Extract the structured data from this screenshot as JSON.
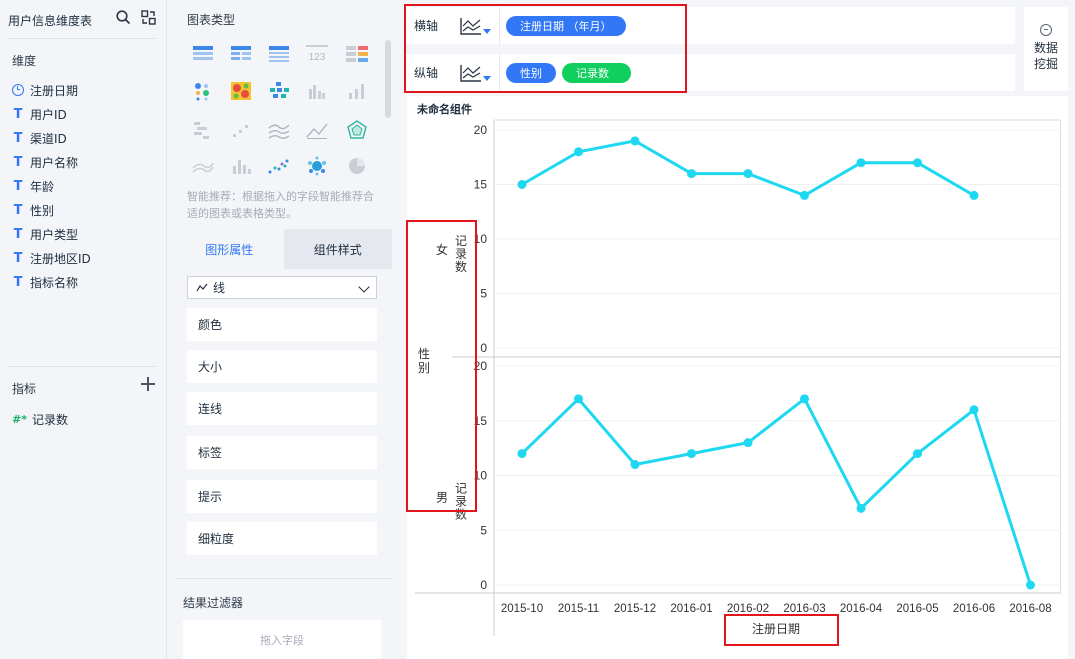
{
  "dataset": {
    "name": "用户信息维度表"
  },
  "dimensions": {
    "title": "维度",
    "fields": [
      {
        "type": "date",
        "label": "注册日期"
      },
      {
        "type": "text",
        "label": "用户ID"
      },
      {
        "type": "text",
        "label": "渠道ID"
      },
      {
        "type": "text",
        "label": "用户名称"
      },
      {
        "type": "text",
        "label": "年龄"
      },
      {
        "type": "text",
        "label": "性别"
      },
      {
        "type": "text",
        "label": "用户类型"
      },
      {
        "type": "text",
        "label": "注册地区ID"
      },
      {
        "type": "text",
        "label": "指标名称"
      }
    ],
    "type_glyph": "T"
  },
  "metrics": {
    "title": "指标",
    "glyph": "#*",
    "fields": [
      {
        "label": "记录数"
      }
    ]
  },
  "config": {
    "chart_type_title": "图表类型",
    "hint": "智能推荐：根据拖入的字段智能推荐合适的图表或表格类型。",
    "tabs": [
      "图形属性",
      "组件样式"
    ],
    "mark_select": {
      "icon": "line-icon",
      "value": "线"
    },
    "properties": [
      "颜色",
      "大小",
      "连线",
      "标签",
      "提示",
      "细粒度"
    ],
    "result_filter": {
      "title": "结果过滤器",
      "placeholder": "拖入字段"
    }
  },
  "axes": {
    "x_label": "横轴",
    "x_pills": [
      {
        "label": "注册日期 （年月）",
        "color": "#3277f6"
      }
    ],
    "y_label": "纵轴",
    "y_pills": [
      {
        "label": "性别",
        "color": "#3277f6"
      },
      {
        "label": "记录数",
        "color": "#10cf5f"
      }
    ]
  },
  "mining": {
    "line1": "数据",
    "line2": "挖掘"
  },
  "colors": {
    "accent": "#3277f6",
    "metric": "#10cf5f",
    "line": "#1ed8f2",
    "highlight": "#e2151c"
  },
  "chart_data": {
    "type": "line",
    "component_name": "未命名组件",
    "row_dimension": "性别",
    "measure": "记录数",
    "xlabel": "注册日期",
    "categories": [
      "2015-10",
      "2015-11",
      "2015-12",
      "2016-01",
      "2016-02",
      "2016-03",
      "2016-04",
      "2016-05",
      "2016-06",
      "2016-08"
    ],
    "ylim_top": [
      0,
      20
    ],
    "ylim_bottom": [
      0,
      20
    ],
    "yticks": [
      20,
      15,
      10,
      5,
      0
    ],
    "series": [
      {
        "name": "女",
        "values": [
          15,
          18,
          19,
          16,
          16,
          14,
          17,
          17,
          14,
          null
        ]
      },
      {
        "name": "男",
        "values": [
          12,
          17,
          11,
          12,
          13,
          17,
          7,
          12,
          16,
          0
        ]
      }
    ]
  }
}
